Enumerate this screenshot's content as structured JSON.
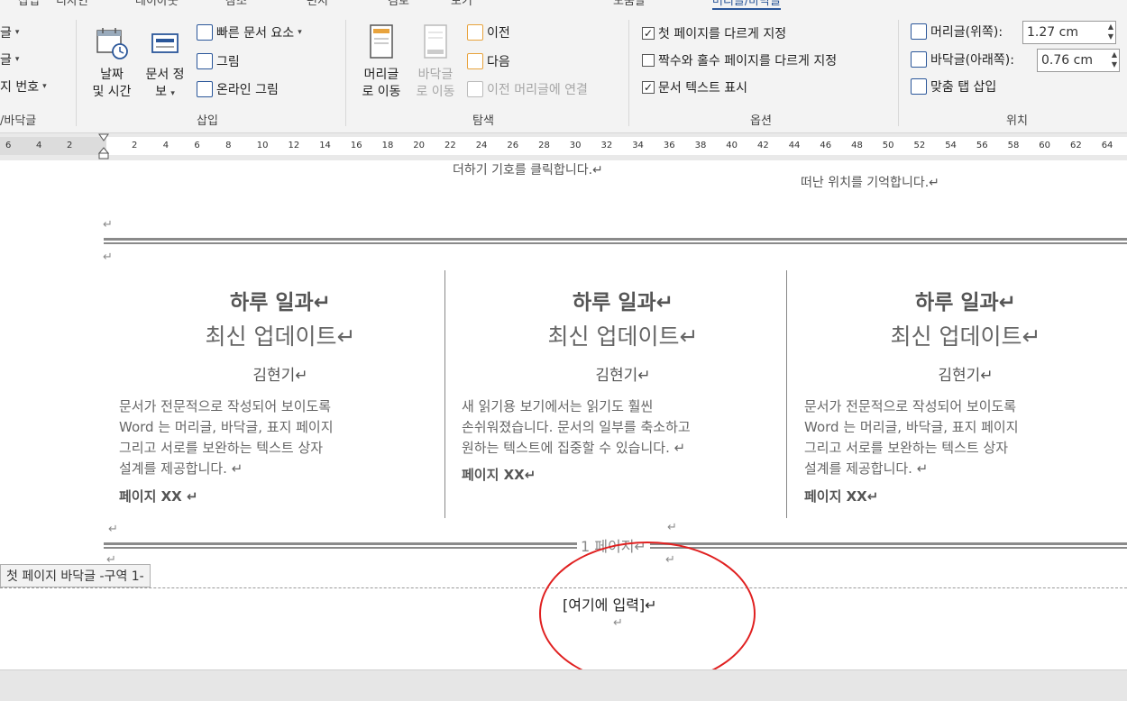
{
  "ribbon": {
    "tab_fragments": [
      "삽입",
      "디자인",
      "레이아웃",
      "참조",
      "편지",
      "검토",
      "보기",
      "도움말",
      "머리글/바닥글"
    ],
    "left_group": {
      "items": [
        "글",
        "글",
        "지 번호"
      ],
      "label": "/바닥글"
    },
    "insert_group": {
      "label": "삽입",
      "date_time": [
        "날짜",
        "및 시간"
      ],
      "doc_info": [
        "문서 정",
        "보"
      ],
      "quick_parts": "빠른 문서 요소",
      "picture": "그림",
      "online_picture": "온라인 그림"
    },
    "nav_group": {
      "label": "탐색",
      "goto_header": [
        "머리글",
        "로 이동"
      ],
      "goto_footer": [
        "바닥글",
        "로 이동"
      ],
      "previous": "이전",
      "next": "다음",
      "link_previous": "이전 머리글에 연결"
    },
    "options_group": {
      "label": "옵션",
      "different_first": {
        "label": "첫 페이지를 다르게 지정",
        "checked": true
      },
      "different_odd_even": {
        "label": "짝수와 홀수 페이지를 다르게 지정",
        "checked": false
      },
      "show_doc_text": {
        "label": "문서 텍스트 표시",
        "checked": true
      }
    },
    "position_group": {
      "label": "위치",
      "header_top": {
        "label": "머리글(위쪽):",
        "value": "1.27 cm"
      },
      "footer_bottom": {
        "label": "바닥글(아래쪽):",
        "value": "0.76 cm"
      },
      "align_tab": "맞춤 탭 삽입"
    }
  },
  "ruler": {
    "left_numbers": [
      "6",
      "4",
      "2"
    ],
    "numbers": [
      "2",
      "4",
      "6",
      "8",
      "10",
      "12",
      "14",
      "16",
      "18",
      "20",
      "22",
      "24",
      "26",
      "28",
      "30",
      "32",
      "34",
      "36",
      "38",
      "40",
      "42",
      "44",
      "46",
      "48",
      "50",
      "52",
      "54",
      "56",
      "58",
      "60",
      "62",
      "64"
    ]
  },
  "document": {
    "para_mark": "↵",
    "prev_text_left": "더하기 기호를 클릭합니다.↵",
    "prev_text_right": "떠난 위치를 기억합니다.↵",
    "columns": [
      {
        "title": "하루 일과↵",
        "subtitle": "최신 업데이트↵",
        "author": "김현기↵",
        "body": [
          "문서가 전문적으로 작성되어 보이도록",
          "Word 는 머리글, 바닥글, 표지 페이지",
          "그리고 서로를 보완하는 텍스트 상자",
          "설계를 제공합니다. ↵"
        ],
        "page": "페이지 XX ↵"
      },
      {
        "title": "하루 일과↵",
        "subtitle": "최신 업데이트↵",
        "author": "김현기↵",
        "body": [
          "새 읽기용 보기에서는 읽기도 훨씬",
          "손쉬워졌습니다. 문서의 일부를 축소하고",
          "원하는 텍스트에 집중할 수 있습니다. ↵"
        ],
        "page": "페이지 XX↵"
      },
      {
        "title": "하루 일과↵",
        "subtitle": "최신 업데이트↵",
        "author": "김현기↵",
        "body": [
          "문서가 전문적으로 작성되어 보이도록",
          "Word 는 머리글, 바닥글, 표지 페이지",
          "그리고 서로를 보완하는 텍스트 상자",
          "설계를 제공합니다. ↵"
        ],
        "page": "페이지 XX↵"
      }
    ],
    "page_number": "1 페이지↵",
    "footer_tab": "첫 페이지 바닥글 -구역 1-",
    "footer_placeholder": "[여기에 입력]↵"
  }
}
